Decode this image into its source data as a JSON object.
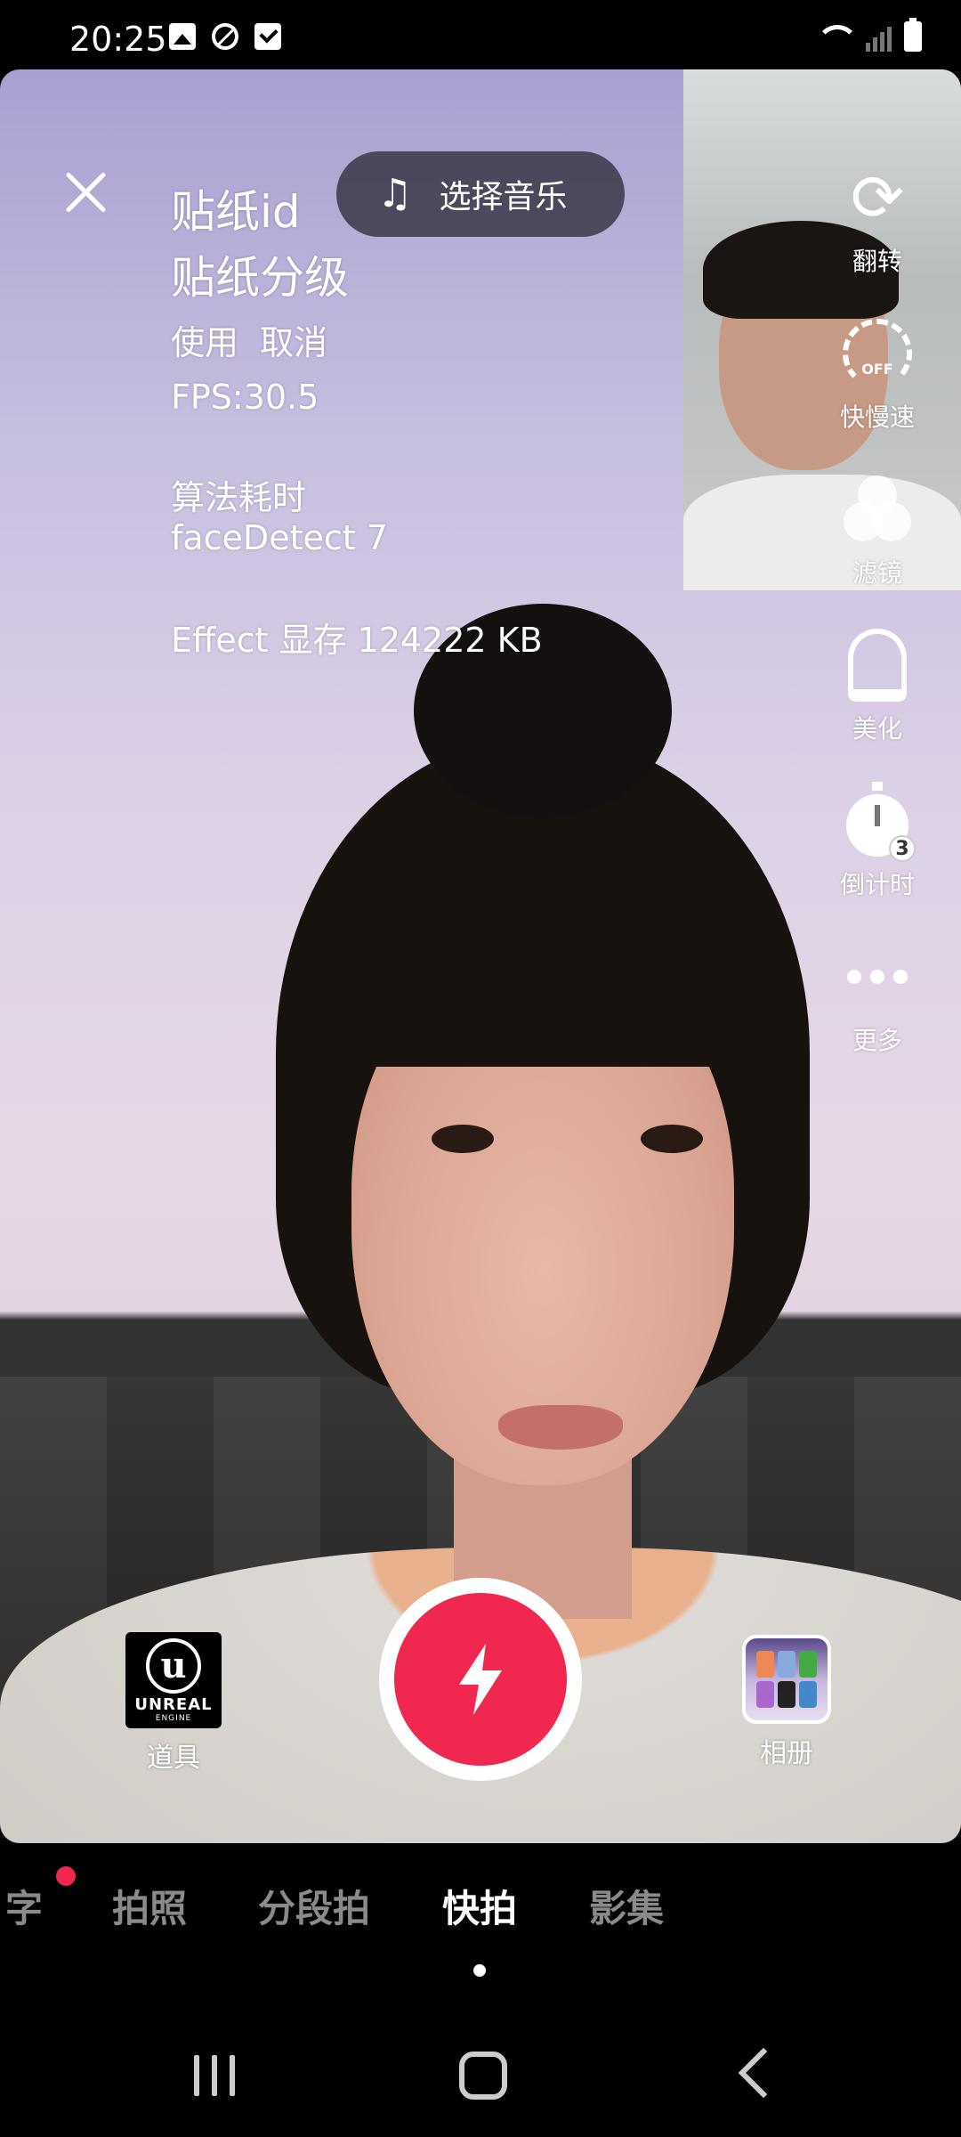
{
  "status_bar": {
    "time": "20:25",
    "left_icons": [
      "image-icon",
      "blocked-icon",
      "checkbox-icon"
    ],
    "right_icons": [
      "wifi-icon",
      "signal-icon",
      "battery-icon"
    ]
  },
  "debug_overlay": {
    "sticker_id": "贴纸id",
    "sticker_level": "贴纸分级",
    "use_label": "使用",
    "cancel_label": "取消",
    "fps": "FPS:30.5",
    "algo_time_label": "算法耗时",
    "face_detect": "faceDetect 7",
    "effect_memory": "Effect 显存 124222 KB"
  },
  "music": {
    "label": "选择音乐",
    "icon": "music-note-icon"
  },
  "right_rail": [
    {
      "label": "翻转",
      "icon": "flip-camera-icon"
    },
    {
      "label": "快慢速",
      "icon": "speed-icon",
      "badge": "OFF"
    },
    {
      "label": "滤镜",
      "icon": "filter-icon"
    },
    {
      "label": "美化",
      "icon": "beauty-icon"
    },
    {
      "label": "倒计时",
      "icon": "timer-icon",
      "badge": "3"
    },
    {
      "label": "更多",
      "icon": "more-icon"
    }
  ],
  "bottom": {
    "props_label": "道具",
    "props_logo_text": "UNREAL",
    "props_logo_sub": "ENGINE",
    "album_label": "相册"
  },
  "mode_tabs": [
    {
      "label": "字",
      "active": false
    },
    {
      "label": "拍照",
      "active": false
    },
    {
      "label": "分段拍",
      "active": false
    },
    {
      "label": "快拍",
      "active": true
    },
    {
      "label": "影集",
      "active": false
    }
  ],
  "colors": {
    "accent": "#f0274e",
    "inactive_tab": "#8a8a8a"
  }
}
